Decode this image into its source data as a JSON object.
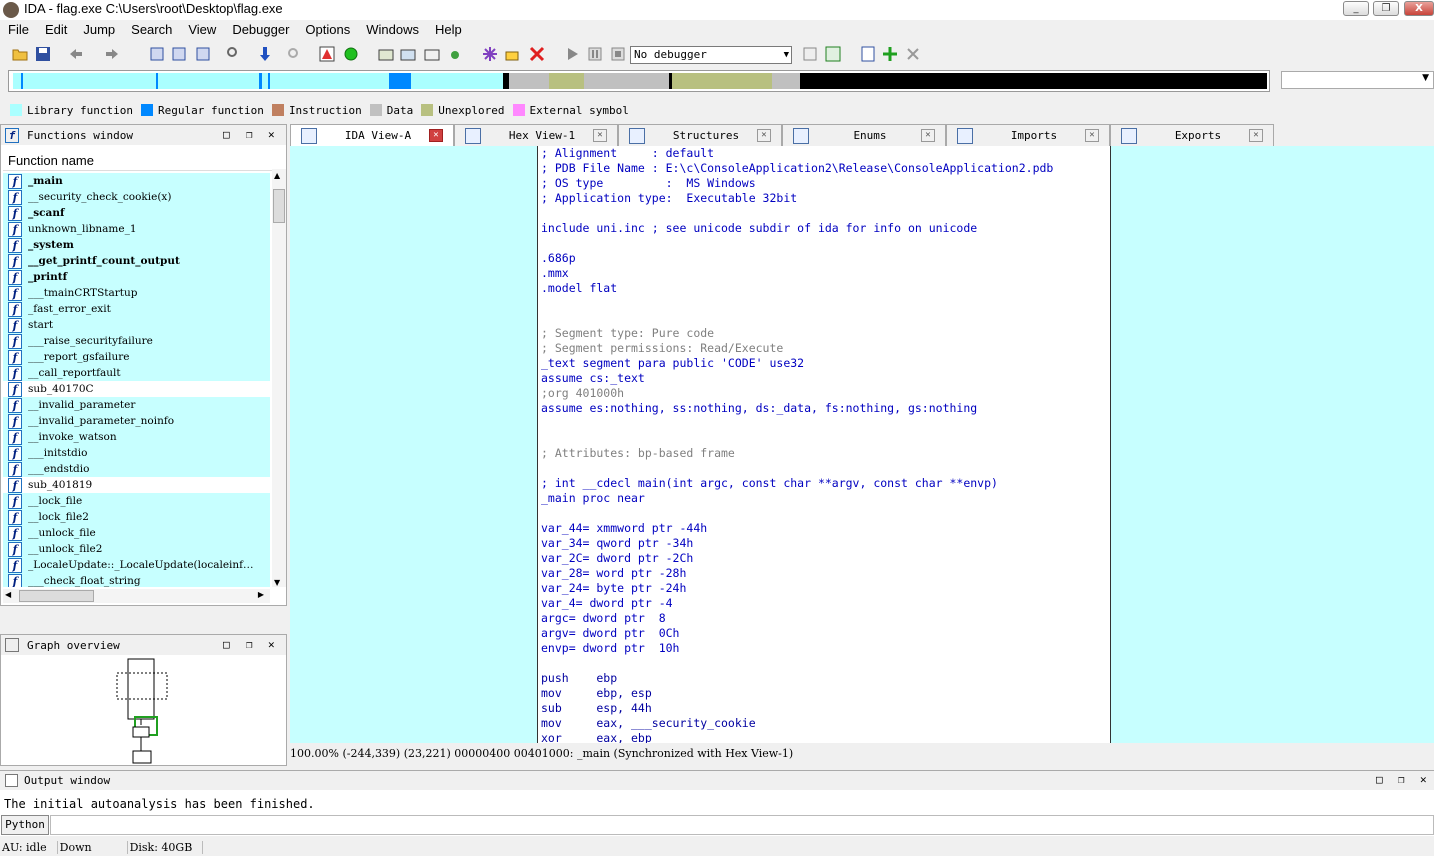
{
  "window": {
    "title": "IDA - flag.exe C:\\Users\\root\\Desktop\\flag.exe",
    "minimize": "_",
    "maximize": "❐",
    "close": "X"
  },
  "menu": [
    "File",
    "Edit",
    "Jump",
    "Search",
    "View",
    "Debugger",
    "Options",
    "Windows",
    "Help"
  ],
  "toolbar": {
    "debugger_select": "No debugger"
  },
  "legend": [
    {
      "label": "Library function",
      "color": "#aaffff"
    },
    {
      "label": "Regular function",
      "color": "#0088ff"
    },
    {
      "label": "Instruction",
      "color": "#c08060"
    },
    {
      "label": "Data",
      "color": "#c0c0c0"
    },
    {
      "label": "Unexplored",
      "color": "#b8c080"
    },
    {
      "label": "External symbol",
      "color": "#ff88ff"
    }
  ],
  "functions_window": {
    "title": "Functions window",
    "column": "Function name",
    "items": [
      {
        "name": "_main",
        "bold": true,
        "lib": true
      },
      {
        "name": "__security_check_cookie(x)",
        "bold": false,
        "lib": true
      },
      {
        "name": "_scanf",
        "bold": true,
        "lib": true
      },
      {
        "name": "unknown_libname_1",
        "bold": false,
        "lib": true
      },
      {
        "name": "_system",
        "bold": true,
        "lib": true
      },
      {
        "name": "__get_printf_count_output",
        "bold": true,
        "lib": true
      },
      {
        "name": "_printf",
        "bold": true,
        "lib": true
      },
      {
        "name": "___tmainCRTStartup",
        "bold": false,
        "lib": true
      },
      {
        "name": "_fast_error_exit",
        "bold": false,
        "lib": true
      },
      {
        "name": "start",
        "bold": false,
        "lib": true
      },
      {
        "name": "___raise_securityfailure",
        "bold": false,
        "lib": true
      },
      {
        "name": "___report_gsfailure",
        "bold": false,
        "lib": true
      },
      {
        "name": "__call_reportfault",
        "bold": false,
        "lib": true
      },
      {
        "name": "sub_40170C",
        "bold": false,
        "lib": false
      },
      {
        "name": "__invalid_parameter",
        "bold": false,
        "lib": true
      },
      {
        "name": "__invalid_parameter_noinfo",
        "bold": false,
        "lib": true
      },
      {
        "name": "__invoke_watson",
        "bold": false,
        "lib": true
      },
      {
        "name": "___initstdio",
        "bold": false,
        "lib": true
      },
      {
        "name": "___endstdio",
        "bold": false,
        "lib": true
      },
      {
        "name": "sub_401819",
        "bold": false,
        "lib": false
      },
      {
        "name": "__lock_file",
        "bold": false,
        "lib": true
      },
      {
        "name": "__lock_file2",
        "bold": false,
        "lib": true
      },
      {
        "name": "__unlock_file",
        "bold": false,
        "lib": true
      },
      {
        "name": "__unlock_file2",
        "bold": false,
        "lib": true
      },
      {
        "name": "_LocaleUpdate::_LocaleUpdate(localeinf…",
        "bold": false,
        "lib": true
      },
      {
        "name": "___check_float_string",
        "bold": false,
        "lib": true
      }
    ]
  },
  "graph_overview": {
    "title": "Graph overview"
  },
  "tabs": [
    {
      "label": "IDA View-A",
      "active": true
    },
    {
      "label": "Hex View-1",
      "active": false
    },
    {
      "label": "Structures",
      "active": false
    },
    {
      "label": "Enums",
      "active": false
    },
    {
      "label": "Imports",
      "active": false
    },
    {
      "label": "Exports",
      "active": false
    }
  ],
  "code": [
    "; Alignment     : default",
    "; PDB File Name : E:\\c\\ConsoleApplication2\\Release\\ConsoleApplication2.pdb",
    "; OS type         :  MS Windows",
    "; Application type:  Executable 32bit",
    "",
    "include uni.inc ; see unicode subdir of ida for info on unicode",
    "",
    ".686p",
    ".mmx",
    ".model flat",
    "",
    "",
    "; Segment type: Pure code",
    "; Segment permissions: Read/Execute",
    "_text segment para public 'CODE' use32",
    "assume cs:_text",
    ";org 401000h",
    "assume es:nothing, ss:nothing, ds:_data, fs:nothing, gs:nothing",
    "",
    "",
    "; Attributes: bp-based frame",
    "",
    "; int __cdecl main(int argc, const char **argv, const char **envp)",
    "_main proc near",
    "",
    "var_44= xmmword ptr -44h",
    "var_34= qword ptr -34h",
    "var_2C= dword ptr -2Ch",
    "var_28= word ptr -28h",
    "var_24= byte ptr -24h",
    "var_4= dword ptr -4",
    "argc= dword ptr  8",
    "argv= dword ptr  0Ch",
    "envp= dword ptr  10h",
    "",
    "push    ebp",
    "mov     ebp, esp",
    "sub     esp, 44h",
    "mov     eax, ___security_cookie",
    "xor     eax, ebp"
  ],
  "status": "100.00% (-244,339) (23,221) 00000400 00401000: _main (Synchronized with Hex View-1)",
  "output": {
    "title": "Output window",
    "text": "The initial autoanalysis has been finished.",
    "python": "Python"
  },
  "bottom": {
    "au": "AU:  idle",
    "dir": "Down",
    "disk": "Disk: 40GB"
  }
}
